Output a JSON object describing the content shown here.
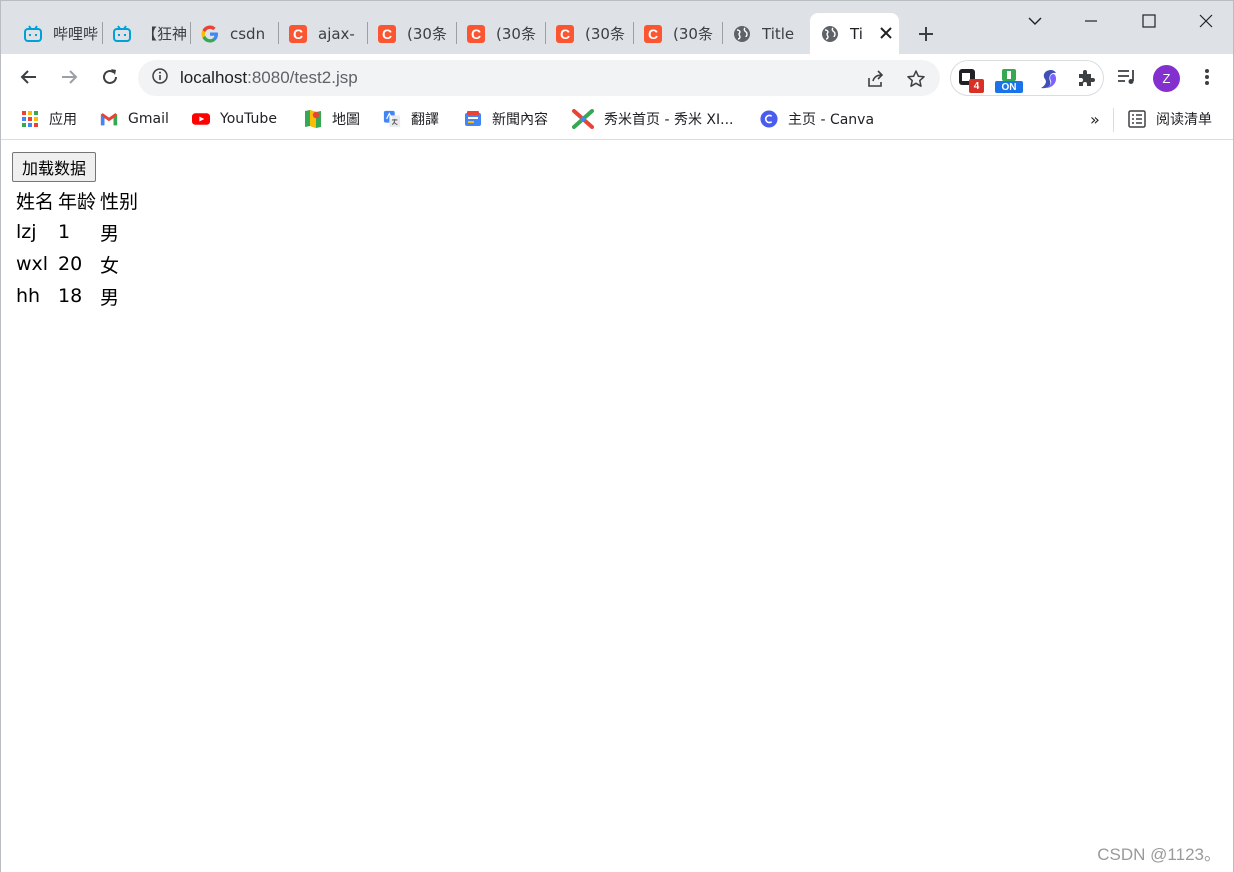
{
  "tabs": [
    {
      "title": "哔哩哔",
      "favicon": "bilibili-icon"
    },
    {
      "title": "【狂神",
      "favicon": "bilibili-icon"
    },
    {
      "title": "csdn",
      "favicon": "google-icon"
    },
    {
      "title": "ajax-",
      "favicon": "csdn-icon"
    },
    {
      "title": "(30条",
      "favicon": "csdn-icon"
    },
    {
      "title": "(30条",
      "favicon": "csdn-icon"
    },
    {
      "title": "(30条",
      "favicon": "csdn-icon"
    },
    {
      "title": "(30条",
      "favicon": "csdn-icon"
    },
    {
      "title": "Title",
      "favicon": "globe-icon"
    },
    {
      "title": "Ti",
      "favicon": "globe-icon",
      "active": true
    }
  ],
  "csdn_favicon_letter": "C",
  "address_bar": {
    "host": "localhost",
    "path": ":8080/test2.jsp"
  },
  "extensions": {
    "badge_count": "4",
    "toggle_label": "ON"
  },
  "profile": {
    "initial": "Z"
  },
  "bookmarks": [
    {
      "label": "应用",
      "icon": "apps-grid-icon"
    },
    {
      "label": "Gmail",
      "icon": "gmail-icon"
    },
    {
      "label": "YouTube",
      "icon": "youtube-icon"
    },
    {
      "label": "地圖",
      "icon": "maps-icon"
    },
    {
      "label": "翻譯",
      "icon": "translate-icon"
    },
    {
      "label": "新聞內容",
      "icon": "news-icon"
    },
    {
      "label": "秀米首页 - 秀米 XI...",
      "icon": "xiumi-icon"
    },
    {
      "label": "主页 - Canva",
      "icon": "canva-icon"
    }
  ],
  "bookmarks_overflow": "»",
  "reading_list": "阅读清单",
  "page": {
    "load_button": "加载数据",
    "table": {
      "headers": [
        "姓名",
        "年龄",
        "性别"
      ],
      "rows": [
        [
          "lzj",
          "1",
          "男"
        ],
        [
          "wxl",
          "20",
          "女"
        ],
        [
          "hh",
          "18",
          "男"
        ]
      ]
    },
    "watermark": "CSDN @1123。"
  },
  "colors": {
    "csdn": "#fc5531",
    "bilibili": "#00a1d6",
    "avatar": "#8430ce",
    "tabstrip": "#dee1e6"
  }
}
